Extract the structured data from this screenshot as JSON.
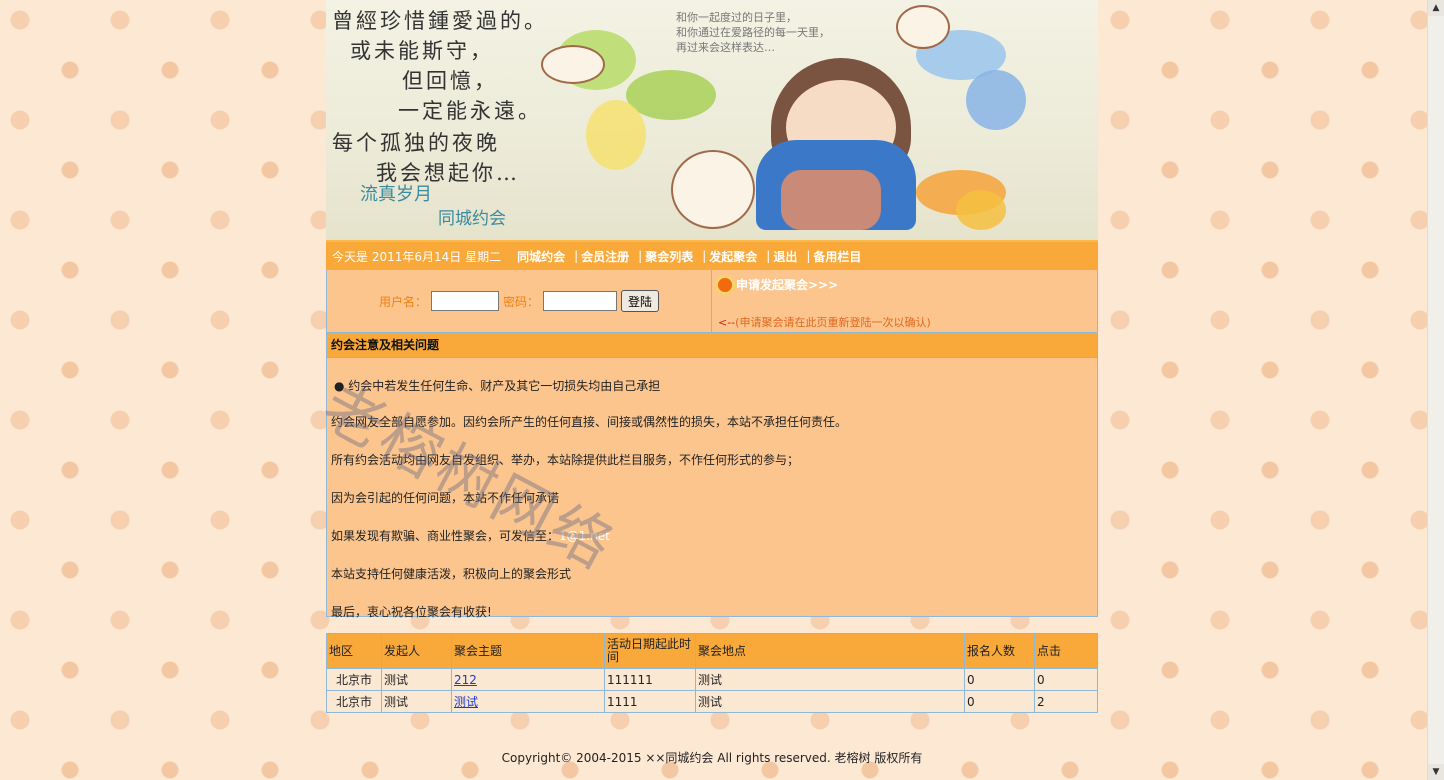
{
  "banner": {
    "lines": [
      "曾經珍惜鍾愛過的。",
      "或未能斯守，",
      "但回憶，",
      "一定能永遠。",
      "每个孤独的夜晚",
      "我会想起你…"
    ],
    "small_text": [
      "和你一起度过的日子里，",
      "和你通过在爱路径的每一天里，",
      "再过来会这样表达…"
    ],
    "signature1": "流真岁月",
    "signature2": "同城约会"
  },
  "navbar": {
    "date": "今天是  2011年6月14日  星期二",
    "links": [
      "同城约会",
      "会员注册",
      "聚会列表",
      "发起聚会",
      "退出",
      "备用栏目"
    ]
  },
  "login": {
    "user_label": "用户名：",
    "user_value": "",
    "pass_label": "密码：",
    "pass_value": "",
    "button": "登陆"
  },
  "apply": {
    "link": "申请发起聚会>>>",
    "arrow": "<--",
    "note": "(申请聚会请在此页重新登陆一次以确认)"
  },
  "notice": {
    "title": "约会注意及相关问题",
    "bullet": "●  约会中若发生任何生命、财产及其它一切损失均由自己承担",
    "p1": "约会网友全部自愿参加。因约会所产生的任何直接、间接或偶然性的损失，本站不承担任何责任。",
    "p2": "所有约会活动均由网友自发组织、举办，本站除提供此栏目服务，不作任何形式的参与；",
    "p3": "因为会引起的任何问题，本站不作任何承诺",
    "p4_prefix": "如果发现有欺骗、商业性聚会，可发信至：",
    "p4_email": "1@1.net",
    "p5": "本站支持任何健康活泼，积极向上的聚会形式",
    "p6": "最后，衷心祝各位聚会有收获!"
  },
  "table": {
    "headers": [
      "地区",
      "发起人",
      "聚会主题",
      "活动日期起此时间",
      "聚会地点",
      "报名人数",
      "点击"
    ],
    "rows": [
      [
        "北京市",
        "测试",
        "212",
        "111111",
        "测试",
        "0",
        "0"
      ],
      [
        "北京市",
        "测试",
        "测试",
        "1111",
        "测试",
        "0",
        "2"
      ]
    ]
  },
  "footer": "Copyright© 2004-2015 ××同城约会  All rights reserved. 老榕树  版权所有",
  "watermark": "老榕树网络"
}
